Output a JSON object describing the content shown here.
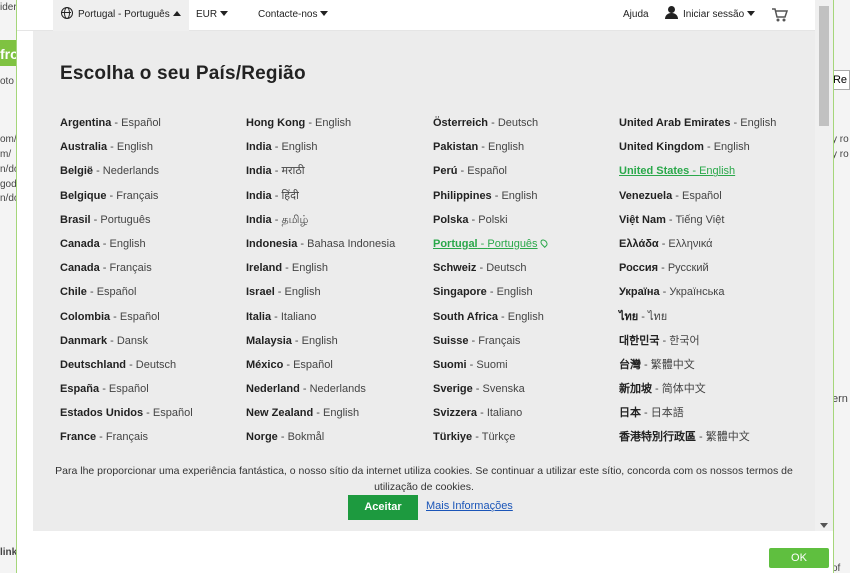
{
  "topbar": {
    "language": "Portugal - Português",
    "currency": "EUR",
    "contact": "Contacte-nos",
    "help": "Ajuda",
    "signin": "Iniciar sessão"
  },
  "title": "Escolha o seu País/Região",
  "columns": [
    [
      {
        "country": "Argentina",
        "language": "Español"
      },
      {
        "country": "Australia",
        "language": "English"
      },
      {
        "country": "België",
        "language": "Nederlands"
      },
      {
        "country": "Belgique",
        "language": "Français"
      },
      {
        "country": "Brasil",
        "language": "Português"
      },
      {
        "country": "Canada",
        "language": "English"
      },
      {
        "country": "Canada",
        "language": "Français"
      },
      {
        "country": "Chile",
        "language": "Español"
      },
      {
        "country": "Colombia",
        "language": "Español"
      },
      {
        "country": "Danmark",
        "language": "Dansk"
      },
      {
        "country": "Deutschland",
        "language": "Deutsch"
      },
      {
        "country": "España",
        "language": "Español"
      },
      {
        "country": "Estados Unidos",
        "language": "Español"
      },
      {
        "country": "France",
        "language": "Français"
      }
    ],
    [
      {
        "country": "Hong Kong",
        "language": "English"
      },
      {
        "country": "India",
        "language": "English"
      },
      {
        "country": "India",
        "language": "मराठी"
      },
      {
        "country": "India",
        "language": "हिंदी"
      },
      {
        "country": "India",
        "language": "தமிழ்"
      },
      {
        "country": "Indonesia",
        "language": "Bahasa Indonesia"
      },
      {
        "country": "Ireland",
        "language": "English"
      },
      {
        "country": "Israel",
        "language": "English"
      },
      {
        "country": "Italia",
        "language": "Italiano"
      },
      {
        "country": "Malaysia",
        "language": "English"
      },
      {
        "country": "México",
        "language": "Español"
      },
      {
        "country": "Nederland",
        "language": "Nederlands"
      },
      {
        "country": "New Zealand",
        "language": "English"
      },
      {
        "country": "Norge",
        "language": "Bokmål"
      }
    ],
    [
      {
        "country": "Österreich",
        "language": "Deutsch"
      },
      {
        "country": "Pakistan",
        "language": "English"
      },
      {
        "country": "Perú",
        "language": "Español"
      },
      {
        "country": "Philippines",
        "language": "English"
      },
      {
        "country": "Polska",
        "language": "Polski"
      },
      {
        "country": "Portugal",
        "language": "Português",
        "selected": true
      },
      {
        "country": "Schweiz",
        "language": "Deutsch"
      },
      {
        "country": "Singapore",
        "language": "English"
      },
      {
        "country": "South Africa",
        "language": "English"
      },
      {
        "country": "Suisse",
        "language": "Français"
      },
      {
        "country": "Suomi",
        "language": "Suomi"
      },
      {
        "country": "Sverige",
        "language": "Svenska"
      },
      {
        "country": "Svizzera",
        "language": "Italiano"
      },
      {
        "country": "Türkiye",
        "language": "Türkçe"
      }
    ],
    [
      {
        "country": "United Arab Emirates",
        "language": "English"
      },
      {
        "country": "United Kingdom",
        "language": "English"
      },
      {
        "country": "United States",
        "language": "English",
        "highlighted": true
      },
      {
        "country": "Venezuela",
        "language": "Español"
      },
      {
        "country": "Việt Nam",
        "language": "Tiếng Việt"
      },
      {
        "country": "Ελλάδα",
        "language": "Ελληνικά"
      },
      {
        "country": "Россия",
        "language": "Русский"
      },
      {
        "country": "Україна",
        "language": "Українська"
      },
      {
        "country": "ไทย",
        "language": "ไทย"
      },
      {
        "country": "대한민국",
        "language": "한국어"
      },
      {
        "country": "台灣",
        "language": "繁體中文"
      },
      {
        "country": "新加坡",
        "language": "简体中文"
      },
      {
        "country": "日本",
        "language": "日本語"
      },
      {
        "country": "香港特別行政區",
        "language": "繁體中文"
      }
    ]
  ],
  "separator": " - ",
  "cookie": {
    "text": "Para lhe proporcionar uma experiência fantástica, o nosso sítio da internet utiliza cookies. Se continuar a utilizar este sítio, concorda com os nossos termos de utilização de cookies.",
    "accept": "Aceitar",
    "more": "Mais Informações"
  },
  "ok_button": "OK",
  "background": {
    "left_fragments": [
      "ider",
      "fro",
      "oto",
      "om/",
      "m/",
      "n/do",
      "goda",
      "n/do",
      "link"
    ],
    "right_fragments": [
      "Re",
      "y ro",
      "y ro",
      "ern",
      "of"
    ]
  },
  "colors": {
    "accent_green": "#1d9a3f",
    "link_green": "#2aa84a",
    "link_blue": "#1a55b8",
    "panel_bg": "#ececec"
  }
}
